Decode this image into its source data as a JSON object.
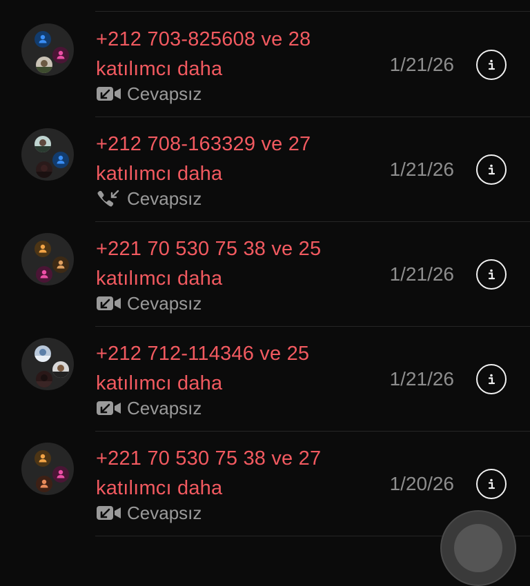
{
  "call_log": [
    {
      "name_line1": "+212 703-825608 ve 28",
      "name_line2": "katılımcı daha",
      "call_type_icon": "missed-video-call-icon",
      "status": "Cevapsız",
      "date": "1/21/26",
      "avatars": [
        {
          "kind": "person",
          "color": "#3a8ff7",
          "bg": "#123c6e"
        },
        {
          "kind": "person",
          "color": "#ec4fa6",
          "bg": "#4a1535"
        },
        {
          "kind": "photo",
          "palette": [
            "#c9c2b5",
            "#6b5a43",
            "#3d4b2e"
          ]
        }
      ]
    },
    {
      "name_line1": "+212 708-163329 ve 27",
      "name_line2": "katılımcı daha",
      "call_type_icon": "missed-phone-call-icon",
      "status": "Cevapsız",
      "date": "1/21/26",
      "avatars": [
        {
          "kind": "photo",
          "palette": [
            "#bfd4d0",
            "#5f4a3f",
            "#2a3a30"
          ]
        },
        {
          "kind": "person",
          "color": "#3a8ff7",
          "bg": "#123c6e"
        },
        {
          "kind": "dark",
          "palette": [
            "#2a1a1a",
            "#3a2020",
            "#1a1010"
          ]
        }
      ]
    },
    {
      "name_line1": "+221 70 530 75 38 ve 25",
      "name_line2": "katılımcı daha",
      "call_type_icon": "missed-video-call-icon",
      "status": "Cevapsız",
      "date": "1/21/26",
      "avatars": [
        {
          "kind": "person",
          "color": "#f3a446",
          "bg": "#4d3515"
        },
        {
          "kind": "person",
          "color": "#e0a060",
          "bg": "#3d2a15"
        },
        {
          "kind": "person",
          "color": "#ec4fa6",
          "bg": "#4a1535"
        }
      ]
    },
    {
      "name_line1": "+212 712-114346 ve 25",
      "name_line2": "katılımcı daha",
      "call_type_icon": "missed-video-call-icon",
      "status": "Cevapsız",
      "date": "1/21/26",
      "avatars": [
        {
          "kind": "photo",
          "palette": [
            "#b9c8da",
            "#5b7fa8",
            "#e8eef5"
          ]
        },
        {
          "kind": "photo",
          "palette": [
            "#d8d8d8",
            "#7a5a40",
            "#222222"
          ]
        },
        {
          "kind": "dark",
          "palette": [
            "#2a1818",
            "#1a1010",
            "#3a2525"
          ]
        }
      ]
    },
    {
      "name_line1": "+221 70 530 75 38 ve 27",
      "name_line2": "katılımcı daha",
      "call_type_icon": "missed-video-call-icon",
      "status": "Cevapsız",
      "date": "1/20/26",
      "avatars": [
        {
          "kind": "person",
          "color": "#f3a446",
          "bg": "#4d3515"
        },
        {
          "kind": "person",
          "color": "#ec4fa6",
          "bg": "#4a1535"
        },
        {
          "kind": "person",
          "color": "#e88a5a",
          "bg": "#3d2015"
        }
      ]
    }
  ],
  "colors": {
    "missed": "#f25a60",
    "secondary_text": "#9a9a9a",
    "date_text": "#8e8e8e",
    "info_icon": "#f2f2f2"
  }
}
